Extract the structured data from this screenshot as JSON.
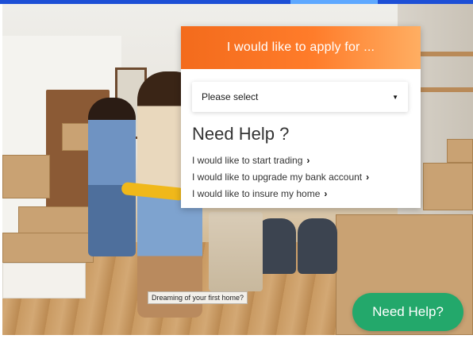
{
  "panel": {
    "title": "I would like to apply for ...",
    "select": {
      "placeholder": "Please select"
    }
  },
  "help": {
    "heading": "Need Help ?",
    "links": [
      {
        "label": "I would like to start trading"
      },
      {
        "label": "I would like to upgrade my bank account"
      },
      {
        "label": "I would like to insure my home"
      }
    ]
  },
  "hero": {
    "caption": "Dreaming of your first home?"
  },
  "fab": {
    "label": "Need Help?"
  },
  "colors": {
    "header_start": "#f36b1c",
    "header_end": "#ffae62",
    "fab": "#23a86b",
    "topbar": "#1d4fd6"
  },
  "icons": {
    "select_caret": "caret-down-icon",
    "link_chevron": "chevron-right-icon"
  }
}
